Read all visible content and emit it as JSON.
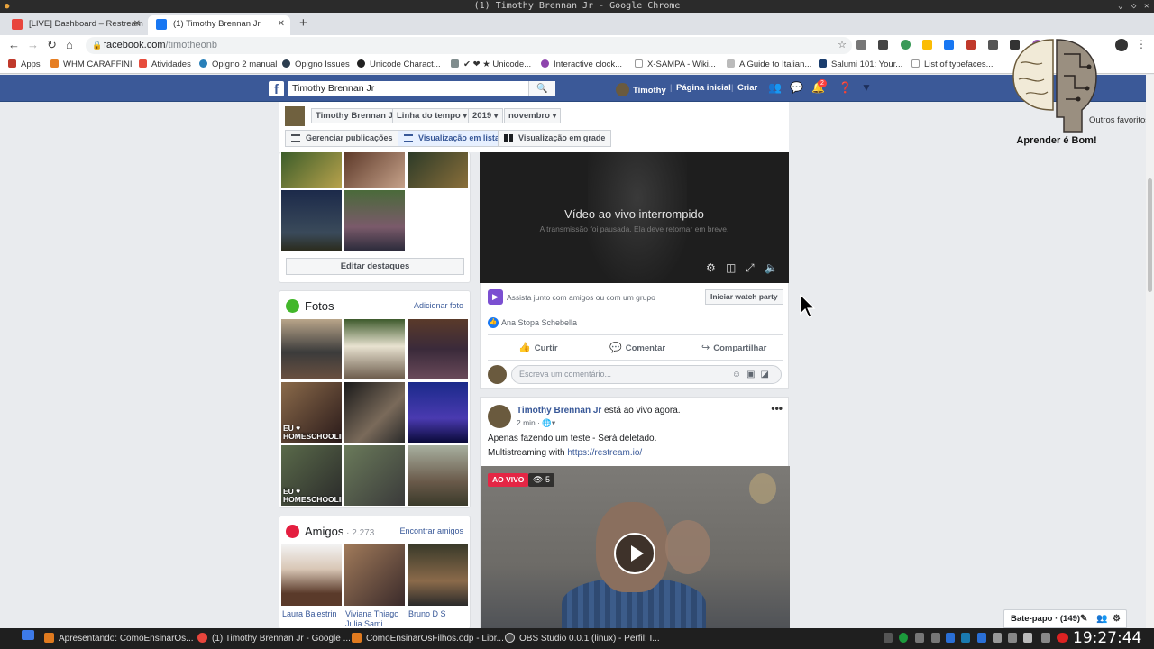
{
  "window": {
    "title": "(1) Timothy Brennan Jr - Google Chrome"
  },
  "tabs": [
    {
      "label": "[LIVE] Dashboard – Restream",
      "icon": "restream-icon",
      "color": "#e8453c"
    },
    {
      "label": "(1) Timothy Brennan Jr",
      "icon": "facebook-icon",
      "color": "#1877f2"
    }
  ],
  "omnibox": {
    "host": "facebook.com",
    "path": "/timotheonb"
  },
  "bookmarks": [
    "Apps",
    "WHM CARAFFINI",
    "Atividades",
    "Opigno 2 manual",
    "Opigno Issues",
    "Unicode Charact...",
    "✔ ❤ ★ Unicode...",
    "Interactive clock...",
    "X-SAMPA - Wiki...",
    "A Guide to Italian...",
    "Salumi 101: Your...",
    "List of typefaces..."
  ],
  "other_bookmarks": "Outros favoritos",
  "fb_header": {
    "logo": "f",
    "search_value": "Timothy Brennan Jr",
    "profile_name": "Timothy",
    "home": "Página inicial",
    "create": "Criar",
    "notifications": "2"
  },
  "timeline": {
    "selects": [
      "Timothy Brennan Jr",
      "Linha do tempo",
      "2019",
      "novembro"
    ],
    "manage_posts": "Gerenciar publicações",
    "list_view": "Visualização em lista",
    "grid_view": "Visualização em grade"
  },
  "highlights": {
    "edit_button": "Editar destaques"
  },
  "photos": {
    "title": "Fotos",
    "add_link": "Adicionar foto",
    "homeschooling_label": "EU ♥\nHOMESCHOOLING"
  },
  "friends": {
    "title": "Amigos",
    "count": " · 2.273",
    "find_link": "Encontrar amigos",
    "names": [
      "Laura Balestrin",
      "Viviana Thiago\nJulia Sami",
      "Bruno D S"
    ]
  },
  "live_video": {
    "title": "Vídeo ao vivo interrompido",
    "subtitle": "A transmissão foi pausada. Ela deve retornar em breve."
  },
  "post1": {
    "watch_party_text": "Assista junto com amigos ou com um grupo",
    "watch_party_button": "Iniciar watch party",
    "liker": "Ana Stopa Schebella",
    "actions": [
      "Curtir",
      "Comentar",
      "Compartilhar"
    ],
    "comment_placeholder": "Escreva um comentário..."
  },
  "post2": {
    "author": "Timothy Brennan Jr",
    "status": " está ao vivo agora.",
    "time": "2 min · ",
    "line1": "Apenas fazendo um teste - Será deletado.",
    "line2_prefix": "Multistreaming with ",
    "link": "https://restream.io/",
    "live_badge": "AO VIVO",
    "viewers": "5"
  },
  "overlay": {
    "caption": "Aprender é Bom!"
  },
  "chat": {
    "label": "Bate-papo · (149)"
  },
  "taskbar": {
    "items": [
      "Apresentando: ComoEnsinarOs...",
      "(1) Timothy Brennan Jr - Google ...",
      "ComoEnsinarOsFilhos.odp - Libr...",
      "OBS Studio 0.0.1 (linux) - Perfil: I..."
    ],
    "clock": "19:27:44"
  }
}
